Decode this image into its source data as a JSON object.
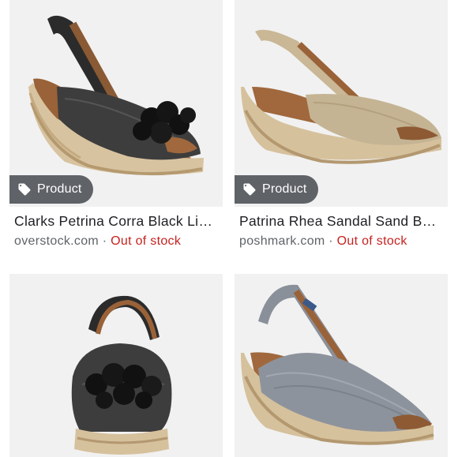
{
  "results": [
    {
      "badge": "Product",
      "title": "Clarks Petrina Corra Black Lin…",
      "source": "overstock.com",
      "separator": " · ",
      "stock": "Out of stock"
    },
    {
      "badge": "Product",
      "title": "Patrina Rhea Sandal Sand Bei…",
      "source": "poshmark.com",
      "separator": " · ",
      "stock": "Out of stock"
    },
    {
      "badge": "",
      "title": "",
      "source": "",
      "separator": "",
      "stock": ""
    },
    {
      "badge": "",
      "title": "",
      "source": "",
      "separator": "",
      "stock": ""
    }
  ],
  "colors": {
    "badge_bg": "#5f6368",
    "out_of_stock": "#c5221f",
    "image_bg": "#f1f1f1"
  },
  "icons": {
    "badge_icon": "tag-icon"
  }
}
